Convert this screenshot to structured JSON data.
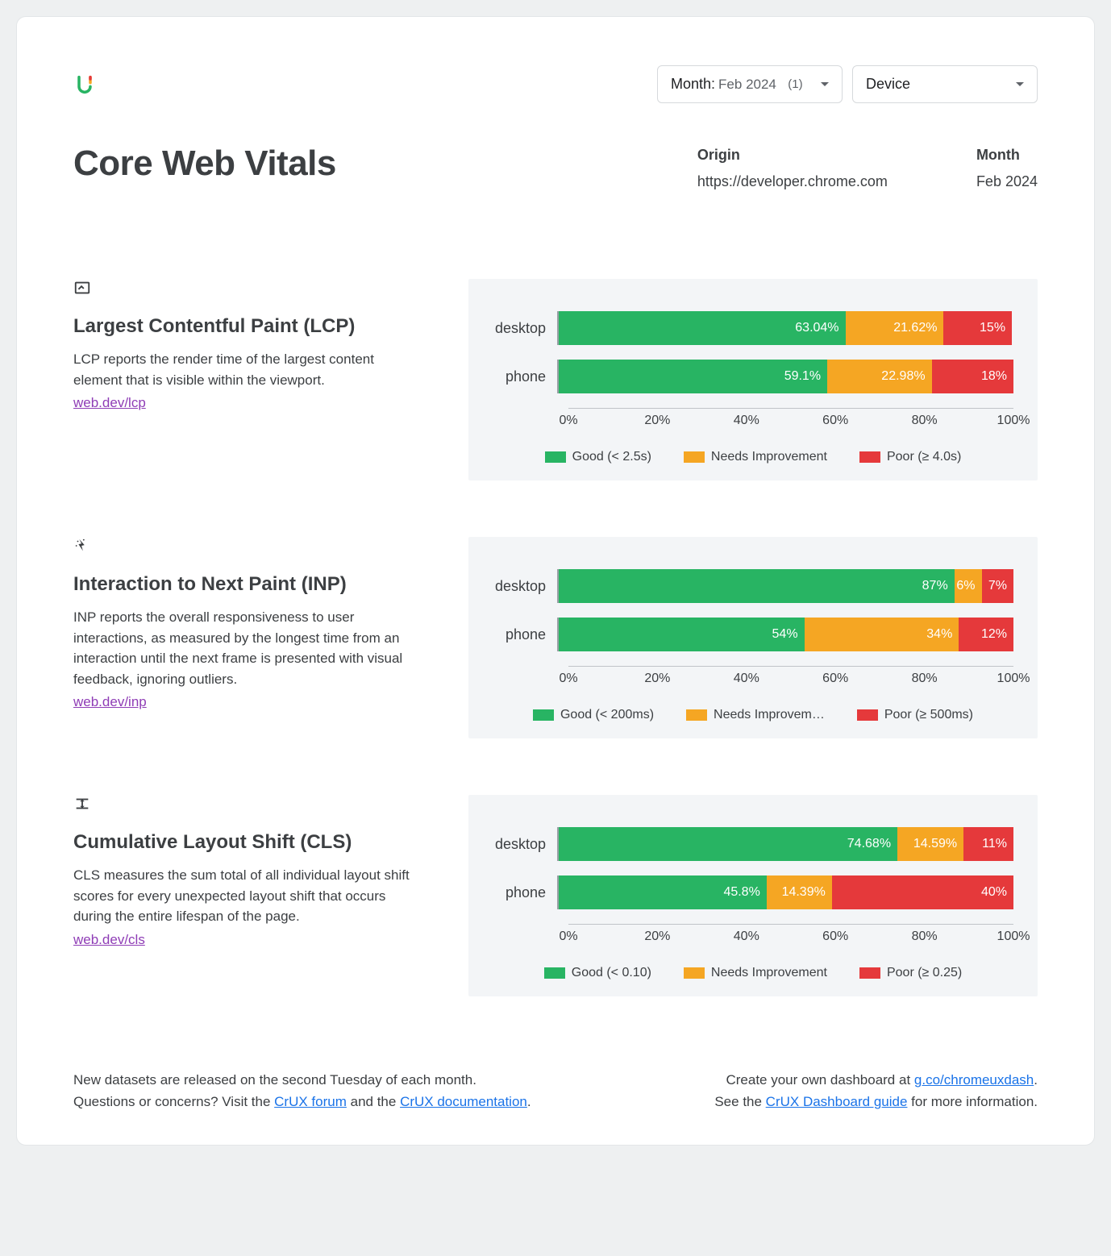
{
  "header": {
    "title": "Core Web Vitals",
    "month_dropdown": {
      "label": "Month",
      "value": "Feb 2024",
      "count": "(1)"
    },
    "device_dropdown": {
      "label": "Device"
    },
    "origin_label": "Origin",
    "origin_value": "https://developer.chrome.com",
    "month_label": "Month",
    "month_value": "Feb 2024"
  },
  "metrics": [
    {
      "id": "lcp",
      "title": "Largest Contentful Paint (LCP)",
      "desc": "LCP reports the render time of the largest content element that is visible within the viewport.",
      "link": "web.dev/lcp",
      "legend": {
        "good": "Good (< 2.5s)",
        "ni": "Needs Improvement",
        "poor": "Poor (≥ 4.0s)"
      },
      "rows": [
        {
          "label": "desktop",
          "good": 63.04,
          "good_txt": "63.04%",
          "ni": 21.62,
          "ni_txt": "21.62%",
          "poor": 15,
          "poor_txt": "15%"
        },
        {
          "label": "phone",
          "good": 59.1,
          "good_txt": "59.1%",
          "ni": 22.98,
          "ni_txt": "22.98%",
          "poor": 18,
          "poor_txt": "18%"
        }
      ]
    },
    {
      "id": "inp",
      "title": "Interaction to Next Paint (INP)",
      "desc": "INP reports the overall responsiveness to user interactions, as measured by the longest time from an interaction until the next frame is presented with visual feedback, ignoring outliers.",
      "link": "web.dev/inp",
      "legend": {
        "good": "Good (< 200ms)",
        "ni": "Needs Improvem…",
        "poor": "Poor (≥ 500ms)"
      },
      "rows": [
        {
          "label": "desktop",
          "good": 87,
          "good_txt": "87%",
          "ni": 6,
          "ni_txt": "6%",
          "poor": 7,
          "poor_txt": "7%"
        },
        {
          "label": "phone",
          "good": 54,
          "good_txt": "54%",
          "ni": 34,
          "ni_txt": "34%",
          "poor": 12,
          "poor_txt": "12%"
        }
      ]
    },
    {
      "id": "cls",
      "title": "Cumulative Layout Shift (CLS)",
      "desc": "CLS measures the sum total of all individual layout shift scores for every unexpected layout shift that occurs during the entire lifespan of the page.",
      "link": "web.dev/cls",
      "legend": {
        "good": "Good (< 0.10)",
        "ni": "Needs Improvement",
        "poor": "Poor (≥ 0.25)"
      },
      "rows": [
        {
          "label": "desktop",
          "good": 74.68,
          "good_txt": "74.68%",
          "ni": 14.59,
          "ni_txt": "14.59%",
          "poor": 11,
          "poor_txt": "11%"
        },
        {
          "label": "phone",
          "good": 45.8,
          "good_txt": "45.8%",
          "ni": 14.39,
          "ni_txt": "14.39%",
          "poor": 40,
          "poor_txt": "40%"
        }
      ]
    }
  ],
  "axis": [
    "0%",
    "20%",
    "40%",
    "60%",
    "80%",
    "100%"
  ],
  "footer": {
    "l1": "New datasets are released on the second Tuesday of each month.",
    "l2a": "Questions or concerns? Visit the ",
    "l2link1": "CrUX forum",
    "l2b": " and the ",
    "l2link2": "CrUX documentation",
    "l2c": ".",
    "r1a": "Create your own dashboard at ",
    "r1link": "g.co/chromeuxdash",
    "r1b": ".",
    "r2a": "See the ",
    "r2link": "CrUX Dashboard guide",
    "r2b": " for more information."
  },
  "chart_data": [
    {
      "type": "bar",
      "stacked": true,
      "orientation": "horizontal",
      "title": "Largest Contentful Paint (LCP)",
      "categories": [
        "desktop",
        "phone"
      ],
      "series": [
        {
          "name": "Good (< 2.5s)",
          "values": [
            63.04,
            59.1
          ]
        },
        {
          "name": "Needs Improvement",
          "values": [
            21.62,
            22.98
          ]
        },
        {
          "name": "Poor (≥ 4.0s)",
          "values": [
            15,
            18
          ]
        }
      ],
      "xlabel": "",
      "ylabel": "",
      "xlim": [
        0,
        100
      ],
      "xticks": [
        0,
        20,
        40,
        60,
        80,
        100
      ],
      "unit": "percent"
    },
    {
      "type": "bar",
      "stacked": true,
      "orientation": "horizontal",
      "title": "Interaction to Next Paint (INP)",
      "categories": [
        "desktop",
        "phone"
      ],
      "series": [
        {
          "name": "Good (< 200ms)",
          "values": [
            87,
            54
          ]
        },
        {
          "name": "Needs Improvement",
          "values": [
            6,
            34
          ]
        },
        {
          "name": "Poor (≥ 500ms)",
          "values": [
            7,
            12
          ]
        }
      ],
      "xlabel": "",
      "ylabel": "",
      "xlim": [
        0,
        100
      ],
      "xticks": [
        0,
        20,
        40,
        60,
        80,
        100
      ],
      "unit": "percent"
    },
    {
      "type": "bar",
      "stacked": true,
      "orientation": "horizontal",
      "title": "Cumulative Layout Shift (CLS)",
      "categories": [
        "desktop",
        "phone"
      ],
      "series": [
        {
          "name": "Good (< 0.10)",
          "values": [
            74.68,
            45.8
          ]
        },
        {
          "name": "Needs Improvement",
          "values": [
            14.59,
            14.39
          ]
        },
        {
          "name": "Poor (≥ 0.25)",
          "values": [
            11,
            40
          ]
        }
      ],
      "xlabel": "",
      "ylabel": "",
      "xlim": [
        0,
        100
      ],
      "xticks": [
        0,
        20,
        40,
        60,
        80,
        100
      ],
      "unit": "percent"
    }
  ]
}
